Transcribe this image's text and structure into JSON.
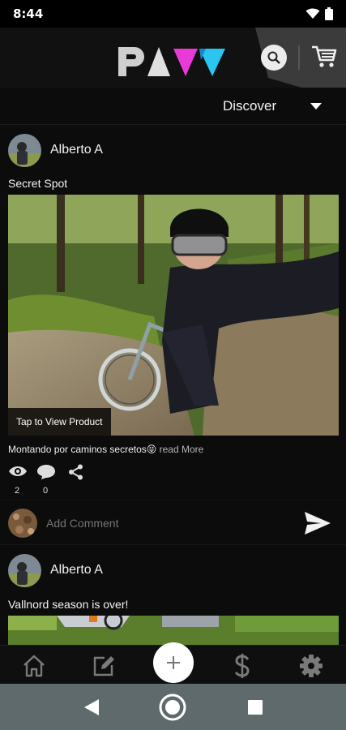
{
  "status_bar": {
    "time": "8:44"
  },
  "header": {
    "logo_icon": "pavv-logo",
    "search_icon": "search-icon",
    "cart_icon": "cart-icon"
  },
  "filter": {
    "label": "Discover"
  },
  "posts": [
    {
      "author": "Alberto A",
      "title": "Secret Spot",
      "product_label": "Tap to View Product",
      "caption": "Montando por caminos secretos😝",
      "read_more": " read More",
      "views": "2",
      "comments": "0"
    },
    {
      "author": "Alberto A",
      "title": "Vallnord season is over!"
    }
  ],
  "comment": {
    "placeholder": "Add Comment"
  },
  "bottom_nav": {
    "items": [
      "home-icon",
      "edit-icon",
      "add-icon",
      "dollar-icon",
      "settings-icon"
    ]
  },
  "colors": {
    "background": "#0c0c0c",
    "logo_magenta": "#e83ad6",
    "logo_cyan": "#2bc6f0",
    "android_nav": "#5e6a6c"
  }
}
